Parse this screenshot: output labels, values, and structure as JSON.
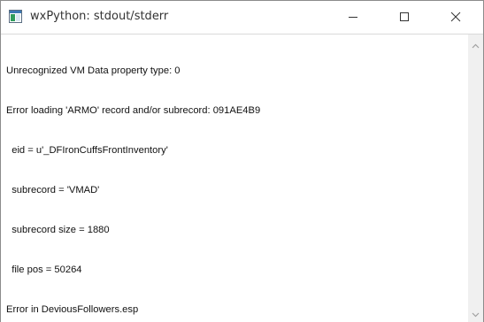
{
  "window": {
    "title": "wxPython: stdout/stderr"
  },
  "icons": {
    "app": "app-window-icon",
    "minimize": "minimize-icon",
    "maximize": "maximize-icon",
    "close": "close-icon",
    "scroll_up": "chevron-up-icon",
    "scroll_down": "chevron-down-icon"
  },
  "log": {
    "lines": [
      "Unrecognized VM Data property type: 0",
      "Error loading 'ARMO' record and/or subrecord: 091AE4B9",
      "  eid = u'_DFIronCuffsFrontInventory'",
      "  subrecord = 'VMAD'",
      "  subrecord size = 1880",
      "  file pos = 50264",
      "Error in DeviousFollowers.esp"
    ]
  },
  "colors": {
    "titlebar_bg": "#ffffff",
    "text": "#111111",
    "scrollbar_bg": "#f0f0f0",
    "arrow": "#a0a0a0"
  }
}
